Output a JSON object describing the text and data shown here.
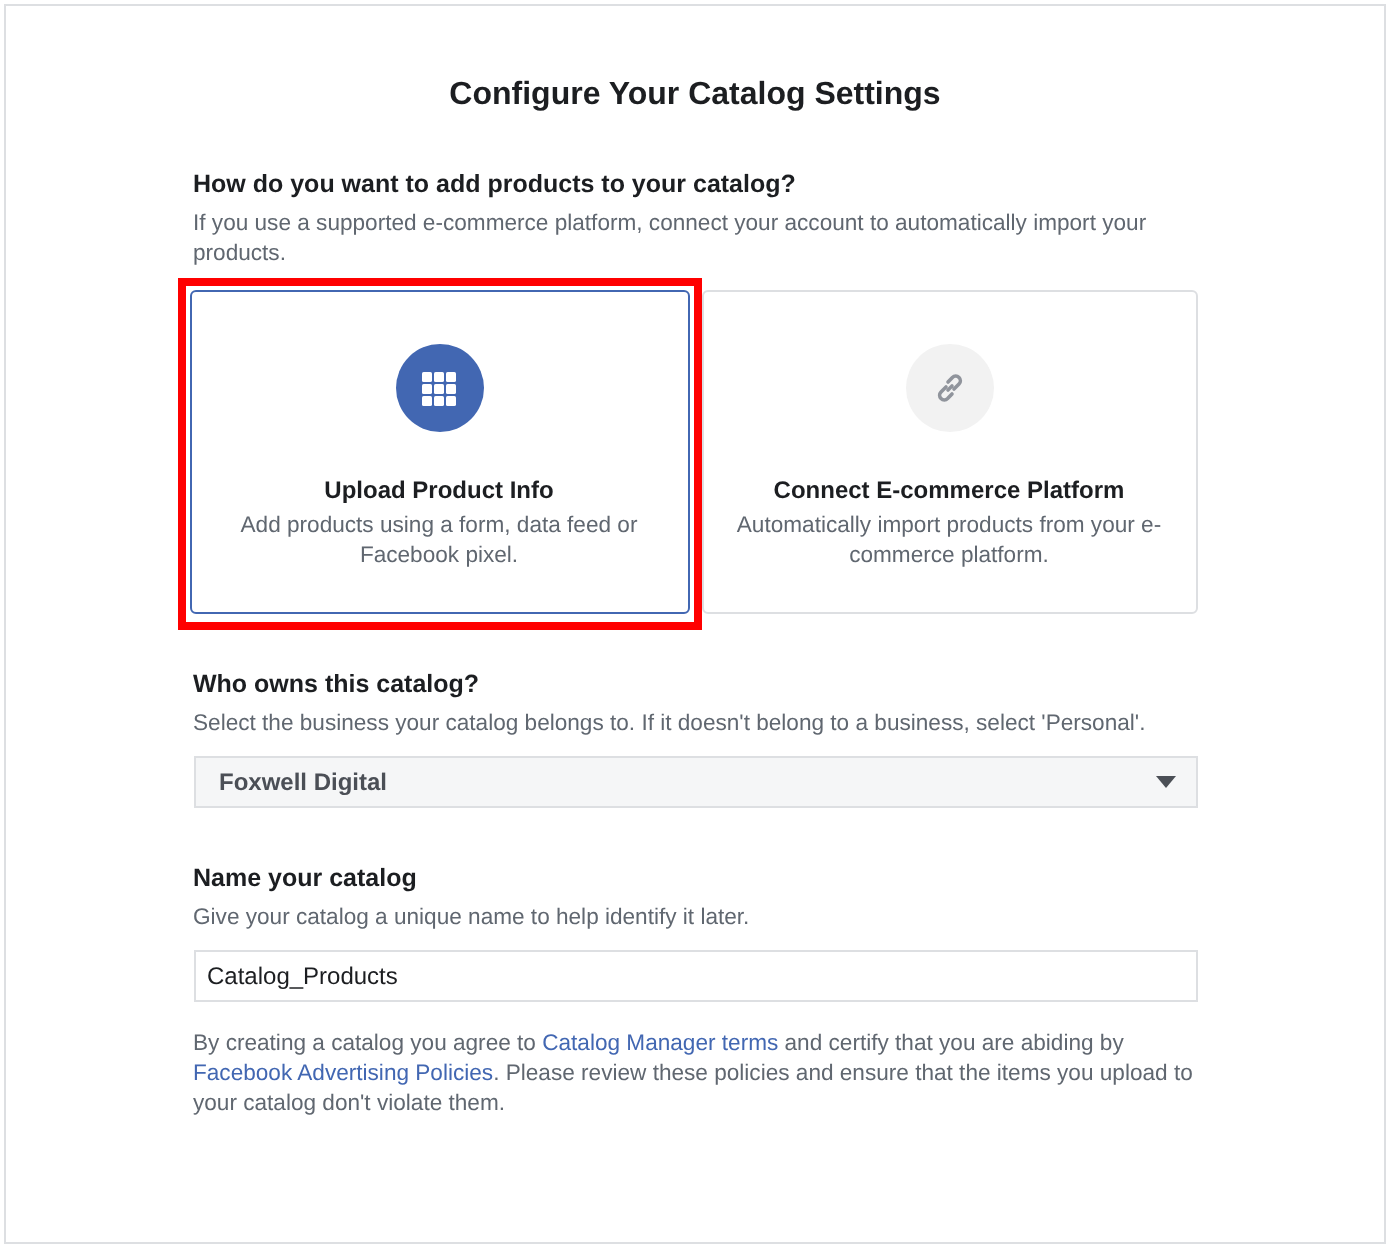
{
  "title": "Configure Your Catalog Settings",
  "method": {
    "heading": "How do you want to add products to your catalog?",
    "help": "If you use a supported e-commerce platform, connect your account to automatically import your products.",
    "options": [
      {
        "kind": "grid",
        "title": "Upload Product Info",
        "description": "Add products using a form, data feed or Facebook pixel.",
        "selected": true,
        "highlighted": true
      },
      {
        "kind": "link",
        "title": "Connect E-commerce Platform",
        "description": "Automatically import products from your e-commerce platform.",
        "selected": false,
        "highlighted": false
      }
    ]
  },
  "owner": {
    "heading": "Who owns this catalog?",
    "help": "Select the business your catalog belongs to. If it doesn't belong to a business, select 'Personal'.",
    "value": "Foxwell Digital"
  },
  "name": {
    "heading": "Name your catalog",
    "help": "Give your catalog a unique name to help identify it later.",
    "value": "Catalog_Products"
  },
  "legal": [
    {
      "text": "By creating a catalog you agree to ",
      "link": false
    },
    {
      "text": "Catalog Manager terms",
      "link": true
    },
    {
      "text": " and certify that you are abiding by ",
      "link": false
    },
    {
      "text": "Facebook Advertising Policies",
      "link": true
    },
    {
      "text": ". Please review these policies and ensure that the items you upload to your catalog don't violate them.",
      "link": false
    }
  ]
}
